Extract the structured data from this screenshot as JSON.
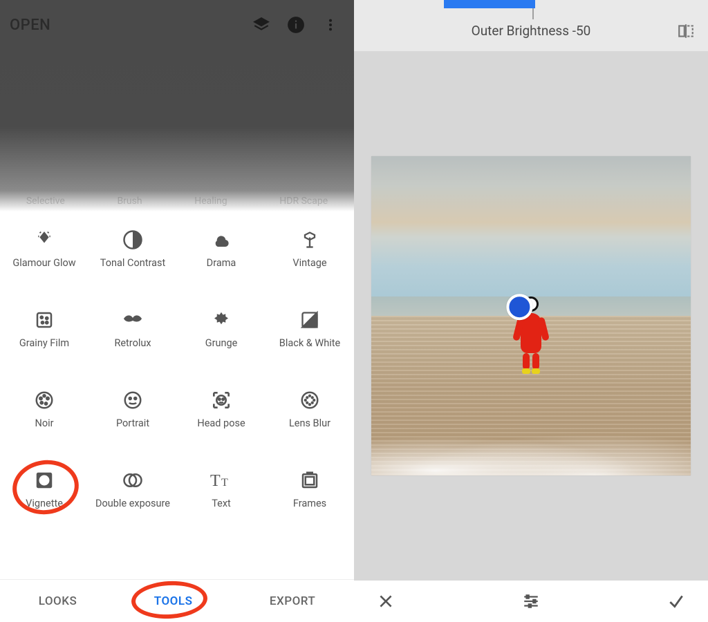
{
  "left": {
    "topbar": {
      "open_label": "OPEN"
    },
    "cutoff_row": [
      "Selective",
      "Brush",
      "Healing",
      "HDR Scape"
    ],
    "tools": [
      {
        "label": "Glamour Glow",
        "icon": "glamour-glow-icon"
      },
      {
        "label": "Tonal Contrast",
        "icon": "tonal-contrast-icon"
      },
      {
        "label": "Drama",
        "icon": "drama-icon"
      },
      {
        "label": "Vintage",
        "icon": "vintage-icon"
      },
      {
        "label": "Grainy Film",
        "icon": "grainy-film-icon"
      },
      {
        "label": "Retrolux",
        "icon": "retrolux-icon"
      },
      {
        "label": "Grunge",
        "icon": "grunge-icon"
      },
      {
        "label": "Black & White",
        "icon": "black-white-icon"
      },
      {
        "label": "Noir",
        "icon": "noir-icon"
      },
      {
        "label": "Portrait",
        "icon": "portrait-icon"
      },
      {
        "label": "Head pose",
        "icon": "head-pose-icon"
      },
      {
        "label": "Lens Blur",
        "icon": "lens-blur-icon"
      },
      {
        "label": "Vignette",
        "icon": "vignette-icon"
      },
      {
        "label": "Double exposure",
        "icon": "double-exposure-icon"
      },
      {
        "label": "Text",
        "icon": "text-icon"
      },
      {
        "label": "Frames",
        "icon": "frames-icon"
      }
    ],
    "tabs": {
      "looks": "LOOKS",
      "tools": "TOOLS",
      "export": "EXPORT",
      "active": "tools"
    },
    "annotations": {
      "highlight_tool": "Vignette",
      "highlight_tab": "TOOLS"
    }
  },
  "right": {
    "adjustment_label": "Outer Brightness -50",
    "adjustment_value": -50,
    "bottom": {
      "cancel": "cancel",
      "adjust": "adjust",
      "confirm": "confirm"
    },
    "colors": {
      "accent_blue": "#2a7af1",
      "center_dot": "#1f56d6"
    }
  }
}
